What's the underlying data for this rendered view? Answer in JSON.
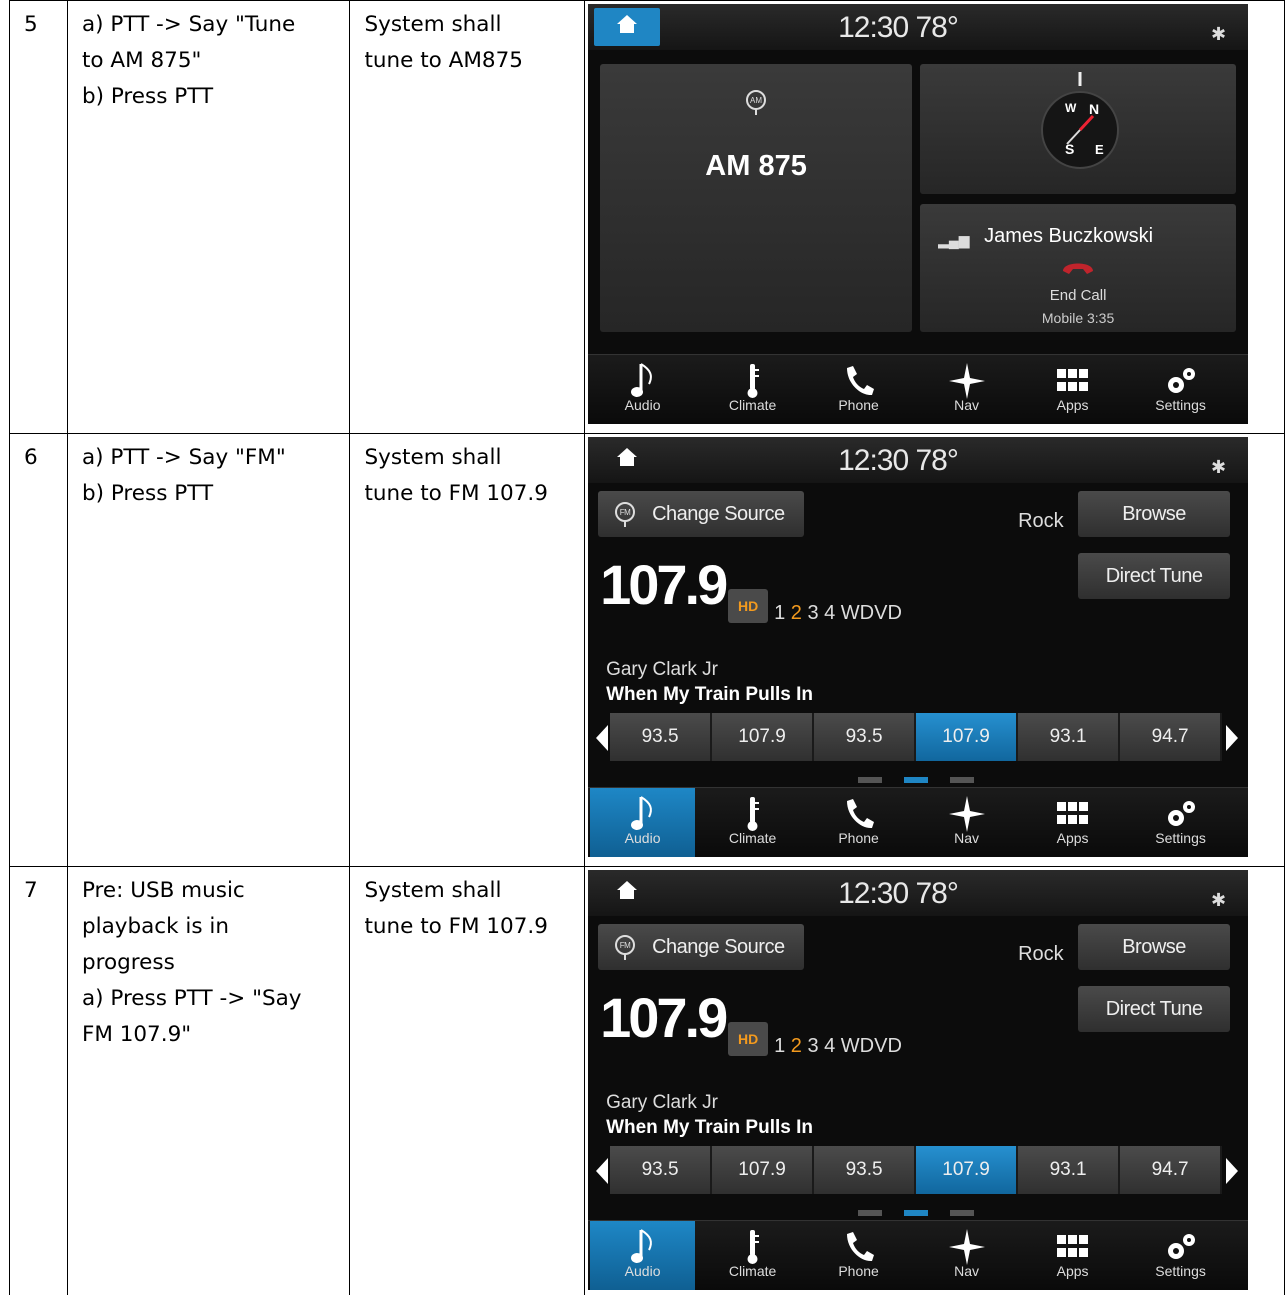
{
  "rows": [
    {
      "num": "5",
      "steps": [
        "a) PTT -> Say \"Tune",
        "to AM 875\"",
        "b) Press PTT"
      ],
      "expected": [
        "System shall",
        "tune to AM875"
      ],
      "screen": {
        "type": "home",
        "clock": "12:30  78°",
        "am_label": "AM 875",
        "caller": "James Buczkowski",
        "end_call": "End Call",
        "mobile": "Mobile 3:35"
      }
    },
    {
      "num": "6",
      "steps": [
        "a) PTT -> Say \"FM\"",
        "b) Press PTT"
      ],
      "expected": [
        "System shall",
        "tune to FM 107.9"
      ],
      "screen": {
        "type": "radio"
      }
    },
    {
      "num": "7",
      "steps": [
        "Pre: USB music",
        "playback is in",
        "progress",
        "a) Press PTT -> \"Say",
        "FM 107.9\""
      ],
      "expected": [
        "System shall",
        "tune to FM 107.9"
      ],
      "screen": {
        "type": "radio"
      }
    }
  ],
  "radio": {
    "clock": "12:30  78°",
    "change_source": "Change Source",
    "genre": "Rock",
    "browse": "Browse",
    "direct_tune": "Direct Tune",
    "frequency": "107.9",
    "hd": "HD",
    "sub_pre": "1 ",
    "sub_hl": "2",
    "sub_post": " 3 4 WDVD",
    "artist": "Gary Clark Jr",
    "song": "When My Train Pulls In",
    "presets": [
      "93.5",
      "107.9",
      "93.5",
      "107.9",
      "93.1",
      "94.7"
    ],
    "active_preset_index": 3
  },
  "nav": [
    "Audio",
    "Climate",
    "Phone",
    "Nav",
    "Apps",
    "Settings"
  ],
  "colors": {
    "accent": "#1f86c4",
    "hd_orange": "#f39a1e",
    "end_call_red": "#c0242c"
  }
}
